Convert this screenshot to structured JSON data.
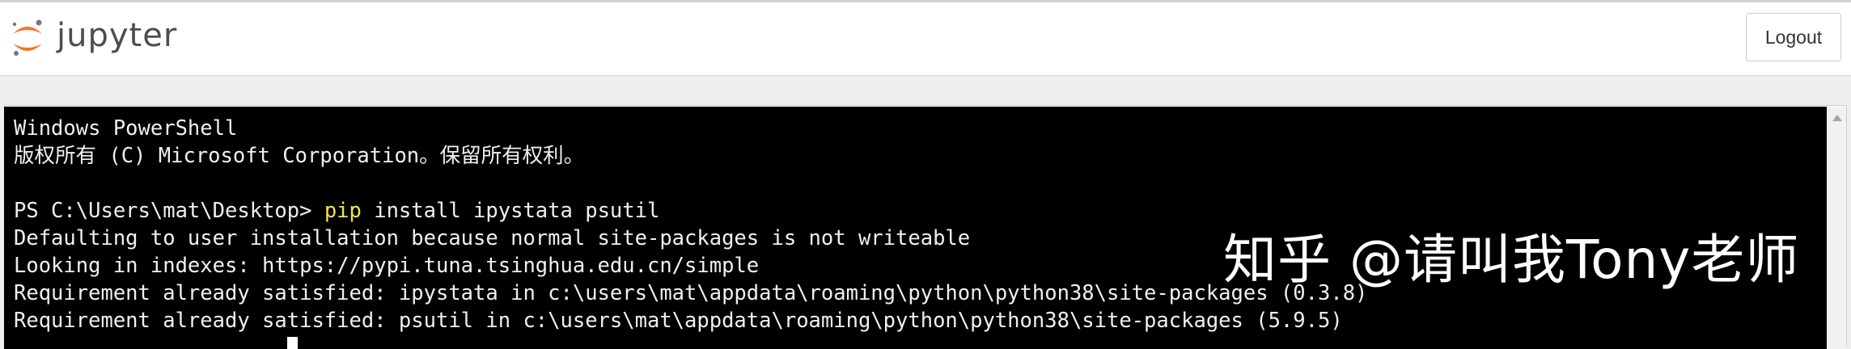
{
  "header": {
    "logo_text": "jupyter",
    "logout_label": "Logout",
    "colors": {
      "logo_orange": "#f37626",
      "logo_gray": "#767677"
    }
  },
  "terminal": {
    "lines": [
      {
        "text": "Windows PowerShell"
      },
      {
        "text": "版权所有 (C) Microsoft Corporation。保留所有权利。"
      },
      {
        "text": ""
      },
      {
        "prompt": "PS C:\\Users\\mat\\Desktop> ",
        "command": "pip",
        "args": " install ipystata psutil"
      },
      {
        "text": "Defaulting to user installation because normal site-packages is not writeable"
      },
      {
        "text": "Looking in indexes: https://pypi.tuna.tsinghua.edu.cn/simple"
      },
      {
        "text": "Requirement already satisfied: ipystata in c:\\users\\mat\\appdata\\roaming\\python\\python38\\site-packages (0.3.8)"
      },
      {
        "text": "Requirement already satisfied: psutil in c:\\users\\mat\\appdata\\roaming\\python\\python38\\site-packages (5.9.5)"
      }
    ],
    "colors": {
      "background": "#000000",
      "text": "#f0f0f0",
      "command": "#f2e44a"
    }
  },
  "watermark": {
    "text": "知乎 @请叫我Tony老师"
  }
}
